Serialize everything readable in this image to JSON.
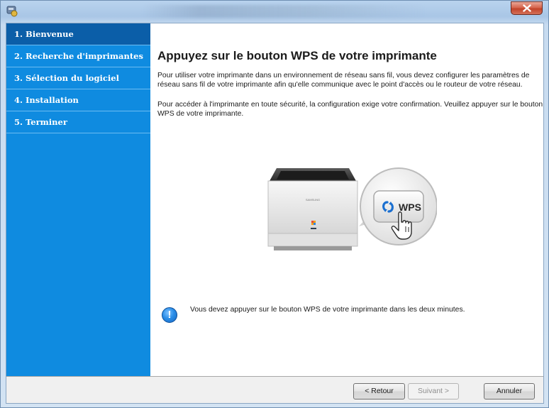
{
  "window": {
    "close_label": "x"
  },
  "sidebar": {
    "items": [
      {
        "label": "1. Bienvenue",
        "active": true
      },
      {
        "label": "2. Recherche d'imprimantes",
        "active": false
      },
      {
        "label": "3. Sélection du logiciel",
        "active": false
      },
      {
        "label": "4. Installation",
        "active": false
      },
      {
        "label": "5. Terminer",
        "active": false
      }
    ]
  },
  "main": {
    "heading": "Appuyez sur le bouton WPS  de votre imprimante",
    "paragraph1": "Pour utiliser votre imprimante dans un environnement de réseau sans fil, vous devez configurer les paramètres de réseau sans fil de votre imprimante afin qu'elle communique avec le point d'accès ou le routeur de votre réseau.",
    "paragraph2": "Pour accéder à l'imprimante en toute sécurité, la configuration exige votre confirmation.  Veuillez appuyer sur le bouton WPS  de votre imprimante.",
    "wps_label": "WPS",
    "printer_brand": "SAMSUNG",
    "notice": "Vous devez appuyer sur le bouton WPS  de votre imprimante dans les deux minutes.",
    "notice_icon_glyph": "!"
  },
  "footer": {
    "back_label": "< Retour",
    "next_label": "Suivant >",
    "cancel_label": "Annuler"
  },
  "colors": {
    "sidebar_bg": "#0f8be0",
    "sidebar_active": "#0b5ea8",
    "close_red": "#c2442a"
  }
}
